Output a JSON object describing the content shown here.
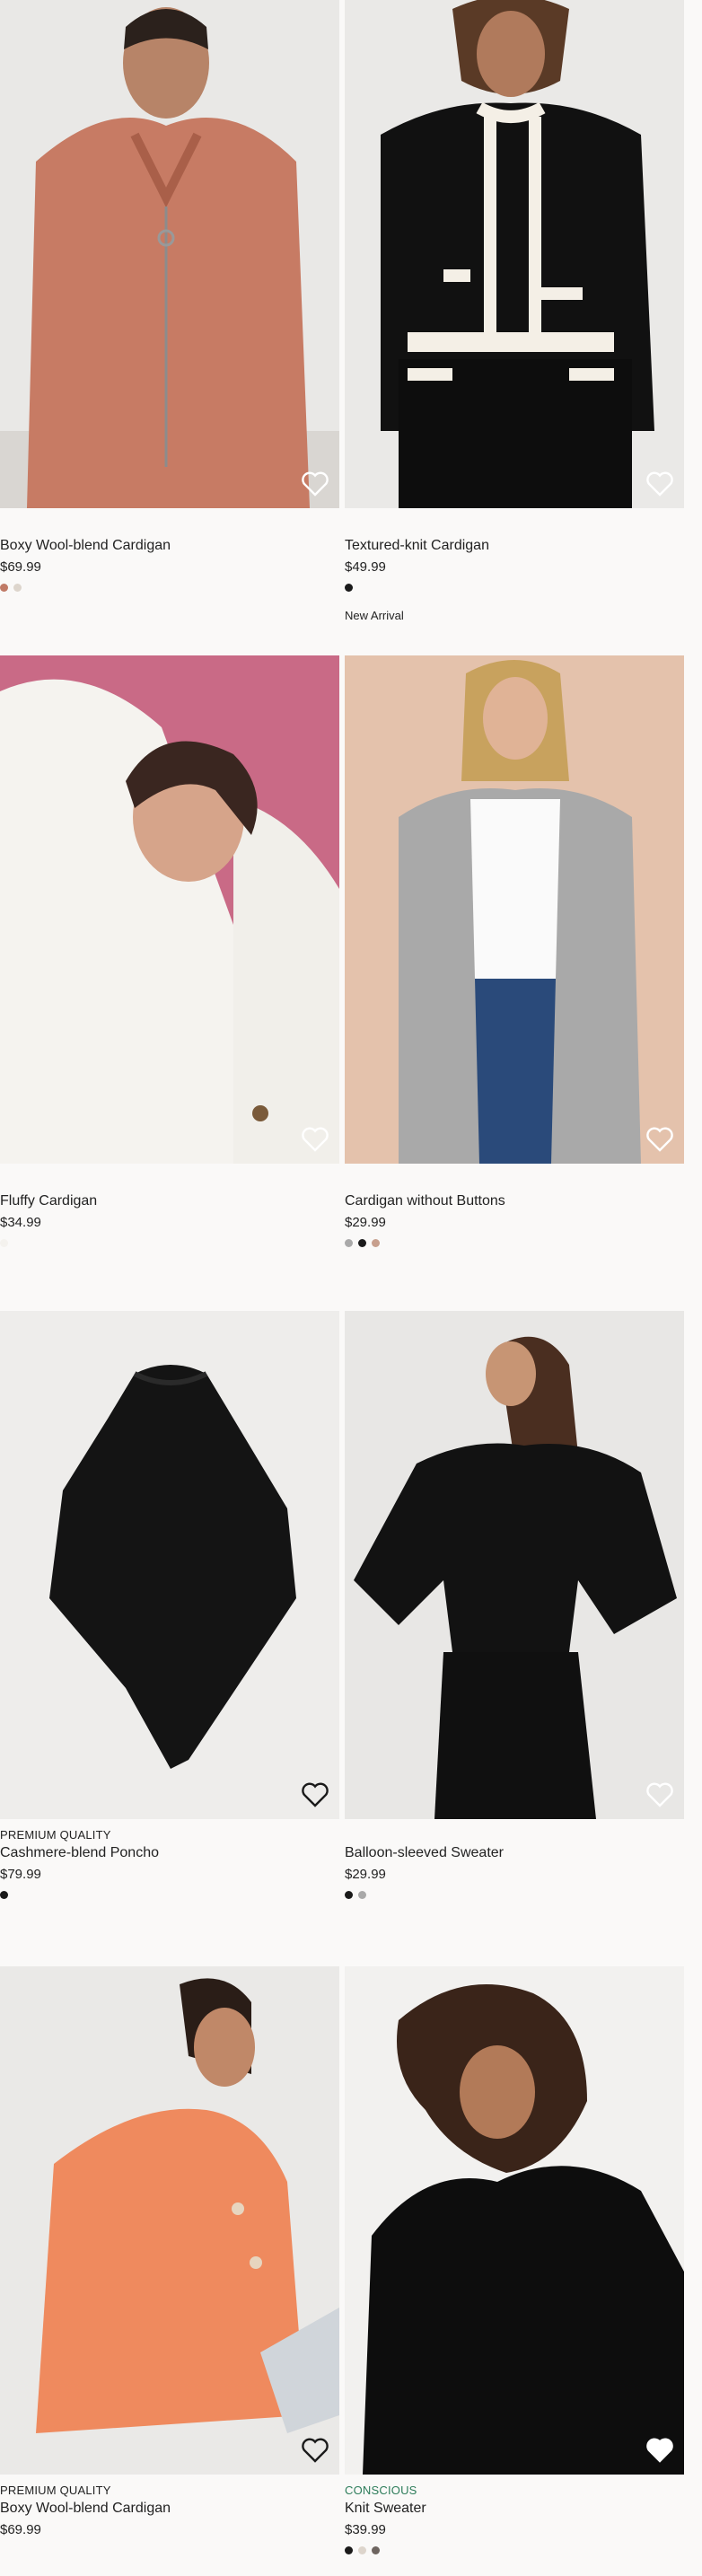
{
  "products": [
    {
      "tag": "",
      "name": "Boxy Wool-blend Cardigan",
      "price": "$69.99",
      "swatches": [
        "#c07a66",
        "#ddd5cc"
      ],
      "marker": ""
    },
    {
      "tag": "",
      "name": "Textured-knit Cardigan",
      "price": "$49.99",
      "swatches": [
        "#1a1a1a"
      ],
      "marker": "New Arrival"
    },
    {
      "tag": "",
      "name": "Fluffy Cardigan",
      "price": "$34.99",
      "swatches": [
        "#f4f2ee"
      ],
      "marker": ""
    },
    {
      "tag": "",
      "name": "Cardigan without Buttons",
      "price": "$29.99",
      "swatches": [
        "#a9a9a9",
        "#1a1a1a",
        "#c79f8d"
      ],
      "marker": ""
    },
    {
      "tag": "PREMIUM QUALITY",
      "name": "Cashmere-blend Poncho",
      "price": "$79.99",
      "swatches": [
        "#1a1a1a"
      ],
      "marker": ""
    },
    {
      "tag": "",
      "name": "Balloon-sleeved Sweater",
      "price": "$29.99",
      "swatches": [
        "#1a1a1a",
        "#a9a9a9"
      ],
      "marker": ""
    },
    {
      "tag": "PREMIUM QUALITY",
      "name": "Boxy Wool-blend Cardigan",
      "price": "$69.99",
      "swatches": [],
      "marker": ""
    },
    {
      "tag": "CONSCIOUS",
      "name": "Knit Sweater",
      "price": "$39.99",
      "swatches": [
        "#1a1a1a",
        "#ddd5cc",
        "#6e6560"
      ],
      "marker": ""
    }
  ],
  "icons": {
    "favorite": "heart-outline-icon"
  },
  "colors": {
    "background": "#faf9f8",
    "conscious_green": "#2e7d5b"
  }
}
